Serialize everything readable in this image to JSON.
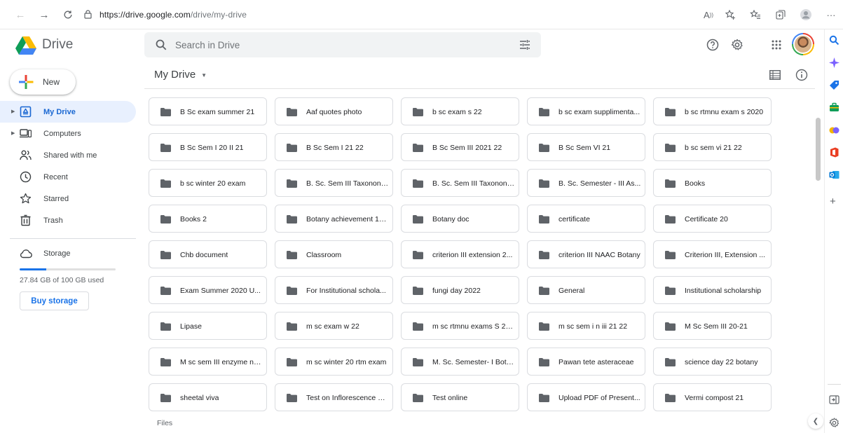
{
  "browser": {
    "url_host": "https://drive.google.com",
    "url_path": "/drive/my-drive",
    "back_icon": "arrow-left-icon",
    "forward_icon": "arrow-right-icon",
    "reload_icon": "reload-icon"
  },
  "header": {
    "brand": "Drive",
    "search_placeholder": "Search in Drive"
  },
  "sidebar": {
    "new_label": "New",
    "items": [
      {
        "label": "My Drive",
        "icon": "my-drive-icon",
        "active": true,
        "expandable": true
      },
      {
        "label": "Computers",
        "icon": "computer-icon",
        "active": false,
        "expandable": true
      },
      {
        "label": "Shared with me",
        "icon": "shared-icon",
        "active": false,
        "expandable": false
      },
      {
        "label": "Recent",
        "icon": "clock-icon",
        "active": false,
        "expandable": false
      },
      {
        "label": "Starred",
        "icon": "star-icon",
        "active": false,
        "expandable": false
      },
      {
        "label": "Trash",
        "icon": "trash-icon",
        "active": false,
        "expandable": false
      }
    ],
    "storage_label": "Storage",
    "storage_used": "27.84 GB of 100 GB used",
    "storage_fraction": 0.2784,
    "buy_storage": "Buy storage"
  },
  "main": {
    "title": "My Drive",
    "files_label": "Files",
    "folders": [
      "B Sc exam summer 21",
      "Aaf quotes photo",
      "b sc exam s 22",
      "b sc exam supplimenta...",
      "b sc rtmnu exam s 2020",
      "B Sc Sem I 20 II 21",
      "B Sc Sem I 21 22",
      "B Sc Sem III 2021 22",
      "B Sc Sem VI 21",
      "b sc sem vi 21 22",
      "b sc winter 20 exam",
      "B. Sc. Sem III Taxonony...",
      "B. Sc. Sem III Taxonony...",
      "B. Sc. Semester - III As...",
      "Books",
      "Books 2",
      "Botany achievement 19...",
      "Botany doc",
      "certificate",
      "Certificate 20",
      "Chb document",
      "Classroom",
      "criterion III extension 2...",
      "criterion III NAAC Botany",
      "Criterion III, Extension ...",
      "Exam Summer 2020 U...",
      "For Institutional schola...",
      "fungi day 2022",
      "General",
      "Institutional scholarship",
      "Lipase",
      "m sc exam w 22",
      "m sc rtmnu exams S 20...",
      "m sc sem i n iii 21 22",
      "M Sc Sem III 20-21",
      "M sc sem III enzyme no...",
      "m sc winter 20 rtm exam",
      "M. Sc. Semester- I Bota...",
      "Pawan tete asteraceae",
      "science day 22 botany",
      "sheetal viva",
      "Test on Inflorescence C...",
      "Test online",
      "Upload PDF of Present...",
      "Vermi compost 21"
    ]
  },
  "colors": {
    "accent": "#1a73e8",
    "active_bg": "#e8f0fe",
    "folder_icon": "#5f6368"
  }
}
